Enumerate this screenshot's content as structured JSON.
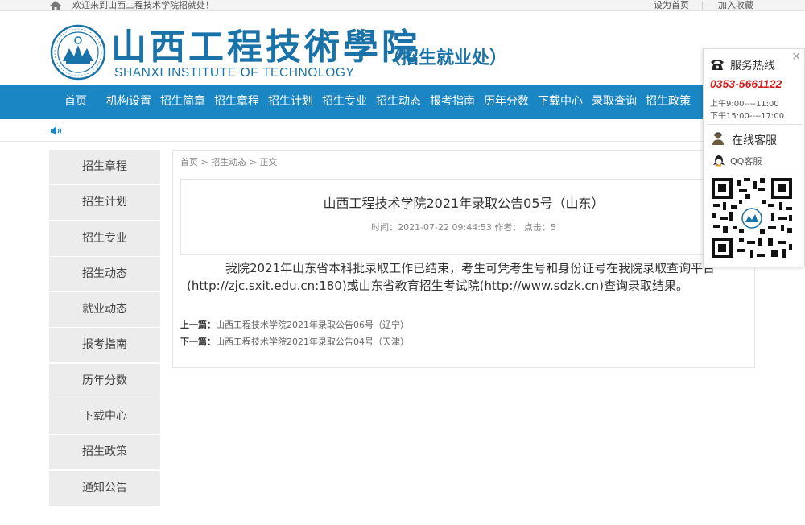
{
  "topbar": {
    "welcome": "欢迎来到山西工程技术学院招就处！",
    "set_home": "设为首页",
    "add_favorite": "加入收藏"
  },
  "header": {
    "cn_name": "山西工程技術學院",
    "en_name": "SHANXI INSTITUTE OF TECHNOLOGY",
    "office": "（招生就业处）"
  },
  "nav": {
    "items": [
      "首页",
      "机构设置",
      "招生简章",
      "招生章程",
      "招生计划",
      "招生专业",
      "招生动态",
      "报考指南",
      "历年分数",
      "下载中心",
      "录取查询",
      "招生政策"
    ]
  },
  "sidebar": {
    "items": [
      "招生章程",
      "招生计划",
      "招生专业",
      "招生动态",
      "就业动态",
      "报考指南",
      "历年分数",
      "下载中心",
      "招生政策",
      "通知公告"
    ]
  },
  "breadcrumb": {
    "home": "首页",
    "sep": ">",
    "section": "招生动态",
    "current": "正文"
  },
  "article": {
    "title": "山西工程技术学院2021年录取公告05号（山东）",
    "meta": "时间：2021-07-22 09:44:53 作者：  点击：5",
    "body": "我院2021年山东省本科批录取工作已结束，考生可凭考生号和身份证号在我院录取查询平台(http://zjc.sxit.edu.cn:180)或山东省教育招生考试院(http://www.sdzk.cn)查询录取结果。",
    "prev_label": "上一篇：",
    "prev_title": "山西工程技术学院2021年录取公告06号（辽宁）",
    "next_label": "下一篇：",
    "next_title": "山西工程技术学院2021年录取公告04号（天津）"
  },
  "float_panel": {
    "close": "×",
    "hotline_title": "服务热线",
    "phone": "0353-5661122",
    "hours_am": "上午9:00----11:00",
    "hours_pm": "下午15:00----17:00",
    "online_title": "在线客服",
    "qq_label": "QQ客服"
  },
  "colors": {
    "brand_blue": "#1a87c4",
    "phone_red": "#d42020"
  }
}
